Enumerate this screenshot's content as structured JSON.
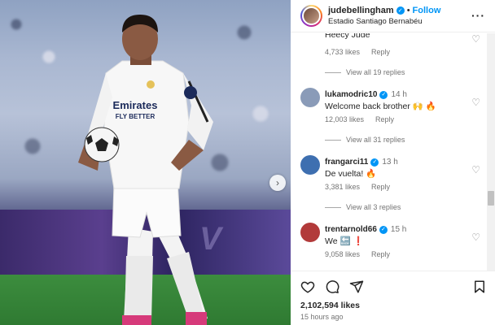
{
  "post": {
    "username": "judebellingham",
    "follow_label": "Follow",
    "separator": "•",
    "location": "Estadio Santiago Bernabéu",
    "likes": "2,102,594 likes",
    "time_ago": "15 hours ago"
  },
  "media": {
    "shirt_sponsor": "Emirates",
    "shirt_sponsor_2": "FLY BETTER",
    "board_text": "V"
  },
  "comments": {
    "clipped_text": "Heecy Jude",
    "first_meta": {
      "likes": "4,733 likes",
      "reply": "Reply"
    },
    "first_view_replies": "View all 19 replies",
    "items": [
      {
        "user": "lukamodric10",
        "time": "14 h",
        "text": "Welcome back brother 🙌 🔥",
        "likes": "12,003 likes",
        "reply": "Reply",
        "view_replies": "View all 31 replies",
        "avatar_color": "#8a9bb8"
      },
      {
        "user": "frangarci11",
        "time": "13 h",
        "text": "De vuelta! 🔥",
        "likes": "3,381 likes",
        "reply": "Reply",
        "view_replies": "View all 3 replies",
        "avatar_color": "#3e6fb0"
      },
      {
        "user": "trentarnold66",
        "time": "15 h",
        "text": "We 🔙 ❗",
        "likes": "9,058 likes",
        "reply": "Reply",
        "avatar_color": "#b23a3a"
      }
    ]
  },
  "colors": {
    "accent": "#0095f6",
    "muted": "#737373",
    "text": "#262626"
  },
  "icons": [
    "more-icon",
    "heart-icon",
    "comment-icon",
    "share-icon",
    "bookmark-icon",
    "verified-icon",
    "chevron-right-icon"
  ]
}
